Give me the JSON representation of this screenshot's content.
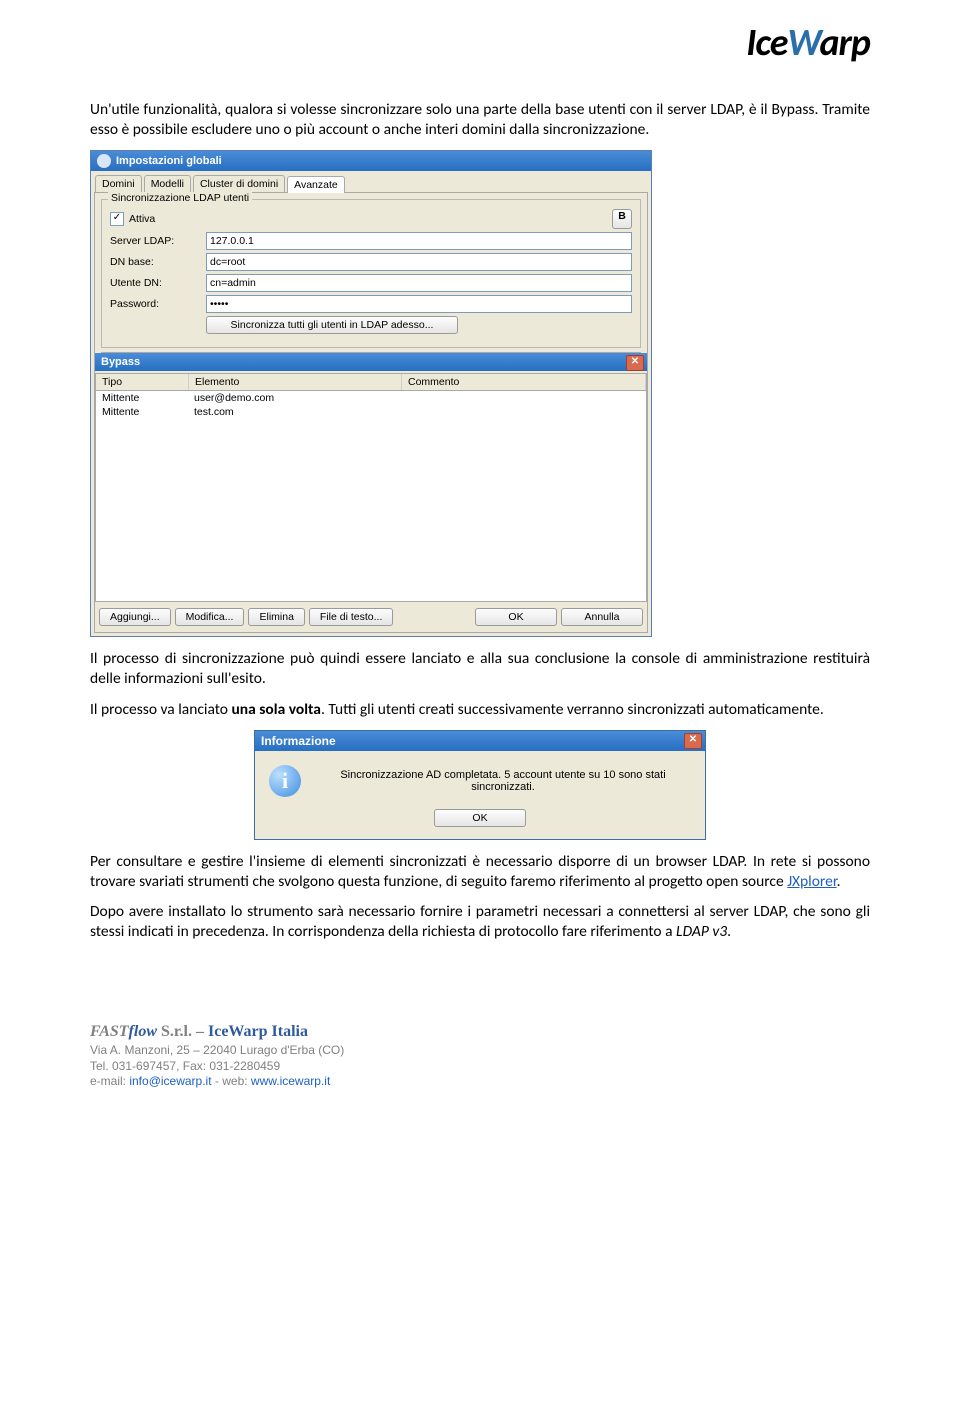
{
  "logo": {
    "text_a": "Ice",
    "text_b": "W",
    "text_c": "arp"
  },
  "p1": "Un'utile funzionalità, qualora si volesse sincronizzare solo una parte della base utenti con il server LDAP, è il Bypass. Tramite esso è possibile escludere uno o più account o anche interi domini dalla sincronizzazione.",
  "win": {
    "title": "Impostazioni globali",
    "tabs": [
      "Domini",
      "Modelli",
      "Cluster di domini",
      "Avanzate"
    ],
    "group_legend": "Sincronizzazione LDAP utenti",
    "attiva_label": "Attiva",
    "labels": {
      "server": "Server LDAP:",
      "dnbase": "DN base:",
      "utente": "Utente DN:",
      "password": "Password:"
    },
    "values": {
      "server": "127.0.0.1",
      "dnbase": "dc=root",
      "utente": "cn=admin",
      "password": "•••••"
    },
    "btn_sync": "Sincronizza tutti gli utenti in LDAP adesso...",
    "b_icon": "B",
    "bypass_title": "Bypass",
    "cols": {
      "tipo": "Tipo",
      "elemento": "Elemento",
      "commento": "Commento"
    },
    "rows": [
      {
        "tipo": "Mittente",
        "elemento": "user@demo.com",
        "commento": ""
      },
      {
        "tipo": "Mittente",
        "elemento": "test.com",
        "commento": ""
      }
    ],
    "btns": {
      "aggiungi": "Aggiungi...",
      "modifica": "Modifica...",
      "elimina": "Elimina",
      "file": "File di testo...",
      "ok": "OK",
      "annulla": "Annulla"
    }
  },
  "p2a": "Il processo di sincronizzazione può quindi essere lanciato e alla sua conclusione la console di amministrazione restituirà delle informazioni sull'esito.",
  "p2b_a": "Il processo va lanciato ",
  "p2b_b": "una sola volta",
  "p2b_c": ". Tutti gli utenti creati successivamente verranno sincronizzati automaticamente.",
  "dlg": {
    "title": "Informazione",
    "msg": "Sincronizzazione AD completata. 5 account utente su 10 sono stati sincronizzati.",
    "ok": "OK"
  },
  "p3a": "Per consultare e gestire l'insieme di elementi sincronizzati è necessario disporre di un browser LDAP. In rete si possono trovare svariati strumenti che svolgono questa funzione, di seguito faremo riferimento al progetto open source ",
  "p3link": "JXplorer",
  "p3b": ".",
  "p4_a": "Dopo avere installato lo strumento sarà necessario fornire i parametri necessari a connettersi al server LDAP, che sono gli stessi indicati in precedenza. In corrispondenza della richiesta di protocollo fare riferimento a ",
  "p4_b": "LDAP v3",
  "p4_c": ".",
  "footer": {
    "fast": "FAST",
    "flow": "flow",
    "srl": " S.r.l.",
    "sep": " – ",
    "iw": "IceWarp Italia",
    "addr": "Via A. Manzoni, 25 – 22040 Lurago d'Erba (CO)",
    "tel": "Tel. 031-697457, Fax: 031-2280459",
    "em_lbl": "e-mail: ",
    "em_val": "info@icewarp.it",
    "web_lbl": " - web: ",
    "web_val": "www.icewarp.it"
  }
}
